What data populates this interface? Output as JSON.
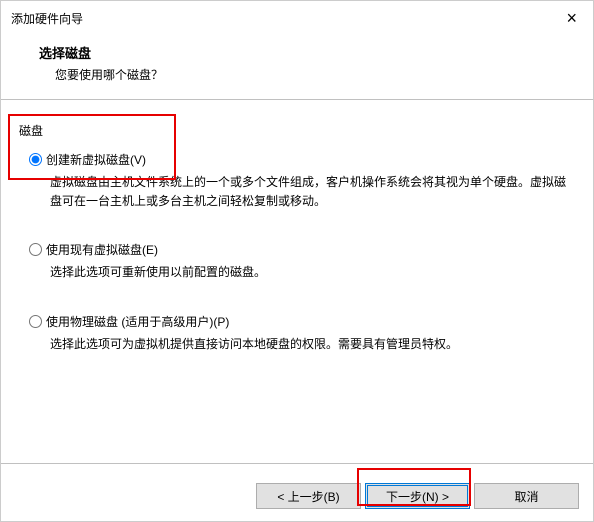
{
  "titlebar": {
    "title": "添加硬件向导",
    "close_label": "×"
  },
  "header": {
    "heading": "选择磁盘",
    "subheading": "您要使用哪个磁盘？"
  },
  "group_label": "磁盘",
  "options": [
    {
      "label": "创建新虚拟磁盘(V)",
      "desc": "虚拟磁盘由主机文件系统上的一个或多个文件组成，客户机操作系统会将其视为单个硬盘。虚拟磁盘可在一台主机上或多台主机之间轻松复制或移动。"
    },
    {
      "label": "使用现有虚拟磁盘(E)",
      "desc": "选择此选项可重新使用以前配置的磁盘。"
    },
    {
      "label": "使用物理磁盘 (适用于高级用户)(P)",
      "desc": "选择此选项可为虚拟机提供直接访问本地硬盘的权限。需要具有管理员特权。"
    }
  ],
  "buttons": {
    "back": "< 上一步(B)",
    "next": "下一步(N) >",
    "cancel": "取消"
  }
}
